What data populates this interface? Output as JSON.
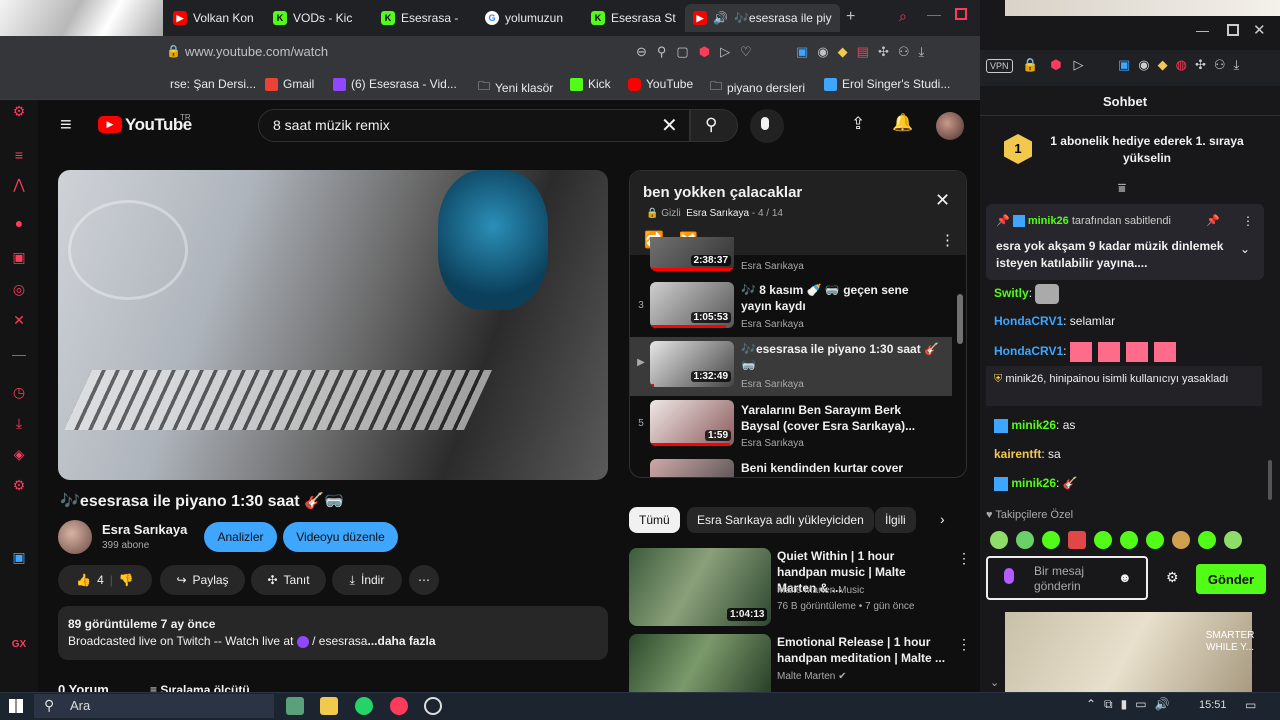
{
  "browser": {
    "tabs": [
      {
        "label": "Volkan Kon",
        "icon_color": "#ff0000",
        "icon": "yt-icon"
      },
      {
        "label": "VODs - Kic",
        "icon_color": "#53fc18",
        "icon": "kick-icon"
      },
      {
        "label": "Esesrasa - ",
        "icon_color": "#53fc18",
        "icon": "kick-icon"
      },
      {
        "label": "yolumuzun",
        "icon_color": "#ffffff",
        "icon": "google-icon"
      },
      {
        "label": "Esesrasa St",
        "icon_color": "#53fc18",
        "icon": "kick-icon"
      },
      {
        "label": "🎶esesrasa ile piy",
        "icon_color": "#ff0000",
        "icon": "yt-icon"
      }
    ],
    "new_tab": "+",
    "url": "www.youtube.com/watch",
    "bookmarks": [
      {
        "label": "rse: Şan Dersi...",
        "color": "#888888"
      },
      {
        "label": "Gmail",
        "color": "#ea4335"
      },
      {
        "label": "(6) Esesrasa - Vid...",
        "color": "#9146ff"
      },
      {
        "label": "Yeni klasör",
        "color": "#e8eaed"
      },
      {
        "label": "Kick",
        "color": "#53fc18"
      },
      {
        "label": "YouTube",
        "color": "#ff0000"
      },
      {
        "label": "piyano dersleri",
        "color": "#e8eaed"
      },
      {
        "label": "Erol Singer's Studi...",
        "color": "#3ea6ff"
      }
    ]
  },
  "youtube": {
    "logo": "YouTube",
    "logo_region": "TR",
    "search_query": "8 saat müzik remix",
    "video": {
      "title": "🎶esesrasa ile piyano 1:30 saat 🎸🥽",
      "channel": "Esra Sarıkaya",
      "subscribers": "399 abone",
      "analytics_label": "Analizler",
      "edit_label": "Videoyu düzenle",
      "likes": "4",
      "share_label": "Paylaş",
      "promote_label": "Tanıt",
      "download_label": "İndir",
      "views_line": "89 görüntüleme  7 ay önce",
      "description_prefix": "Broadcasted live on Twitch -- Watch live at",
      "description_link": "/ esesrasa",
      "more_label": "...daha fazla",
      "comments_peek": "0 Yorum",
      "sort_peek": "Sıralama ölçütü"
    },
    "playlist": {
      "title": "ben yokken çalacaklar",
      "privacy": "Gizli",
      "owner": "Esra Sarıkaya",
      "position": "- 4 / 14",
      "items": [
        {
          "index": "",
          "duration": "2:38:37",
          "title": "",
          "channel": "Esra Sarıkaya",
          "progress": 1.0
        },
        {
          "index": "3",
          "duration": "1:05:53",
          "title": "🎶 8 kasım 🍼 🥽 geçen sene yayın kaydı",
          "channel": "Esra Sarıkaya",
          "progress": 0.9
        },
        {
          "index": "▶",
          "duration": "1:32:49",
          "title": "🎶esesrasa ile piyano 1:30 saat 🎸🥽",
          "channel": "Esra Sarıkaya",
          "progress": 0.05
        },
        {
          "index": "5",
          "duration": "1:59",
          "title": "Yaralarını Ben Sarayım Berk Baysal (cover Esra Sarıkaya)...",
          "channel": "Esra Sarıkaya",
          "progress": 0.95
        },
        {
          "index": "",
          "duration": "",
          "title": "Beni kendinden kurtar cover",
          "channel": "",
          "progress": 0
        }
      ]
    },
    "chips": [
      "Tümü",
      "Esra Sarıkaya adlı yükleyiciden",
      "İlgili"
    ],
    "recommendations": [
      {
        "title": "Quiet Within | 1 hour handpan music | Malte Marten & ...",
        "channel": "Malte Marten Music",
        "meta": "76 B görüntüleme • 7 gün önce",
        "duration": "1:04:13"
      },
      {
        "title": "Emotional Release | 1 hour handpan meditation | Malte ...",
        "channel": "Malte Marten ✔",
        "meta": "",
        "duration": ""
      }
    ]
  },
  "chat": {
    "title": "Sohbet",
    "gift_banner": "1 abonelik hediye ederek 1. sıraya yükselin",
    "gift_rank": "1",
    "pinned_by": "minik26",
    "pinned_by_suffix": "tarafından sabitlendi",
    "pinned_text": "esra yok akşam 9 kadar müzik dinlemek isteyen katılabilir yayına....",
    "messages": [
      {
        "user": "Switly",
        "text": "",
        "user_color": "#53fc18"
      },
      {
        "user": "HondaCRV1",
        "text": "selamlar",
        "user_color": "#3ea6ff"
      },
      {
        "user": "HondaCRV1",
        "text": "",
        "user_color": "#3ea6ff"
      },
      {
        "user": "minik26",
        "text": "as",
        "user_color": "#53fc18"
      },
      {
        "user": "kairentft",
        "text": "sa",
        "user_color": "#f2c94c"
      },
      {
        "user": "minik26",
        "text": "",
        "user_color": "#53fc18"
      }
    ],
    "ban_notice": "minik26, hinipainou isimli kullanıcıyı yasakladı",
    "follower_only": "Takipçilere Özel",
    "input_placeholder": "Bir mesaj gönderin",
    "send_label": "Gönder",
    "overlay_text": "SMARTER WHILE Y..."
  },
  "taskbar": {
    "search_label": "Ara",
    "time": "15:51"
  },
  "colors": {
    "youtube_red": "#ff0000",
    "kick_green": "#53fc18",
    "link_blue": "#3ea6ff",
    "twitch_pink": "#ff3b5c"
  }
}
